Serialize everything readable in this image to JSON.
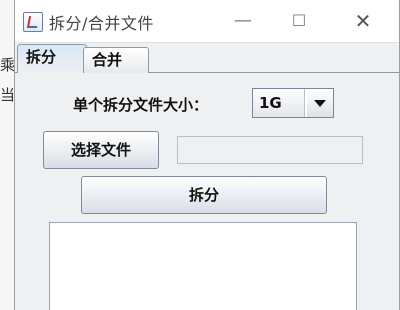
{
  "background": {
    "fragments": [
      "乘",
      "当"
    ]
  },
  "window": {
    "title": "拆分/合并文件",
    "controls": {
      "min": "—",
      "max": "☐",
      "close": "✕"
    }
  },
  "tabs": [
    {
      "label": "拆分",
      "active": true
    },
    {
      "label": "合并",
      "active": false
    }
  ],
  "split_panel": {
    "size_label": "单个拆分文件大小：",
    "size_value": "1G",
    "choose_file_label": "选择文件",
    "file_path_value": "",
    "split_button_label": "拆分",
    "log_text": ""
  },
  "colors": {
    "window_bg": "#eef0f2",
    "active_tab": "#d6e7f6",
    "button_top": "#ffffff",
    "button_bottom": "#d8dee6"
  }
}
